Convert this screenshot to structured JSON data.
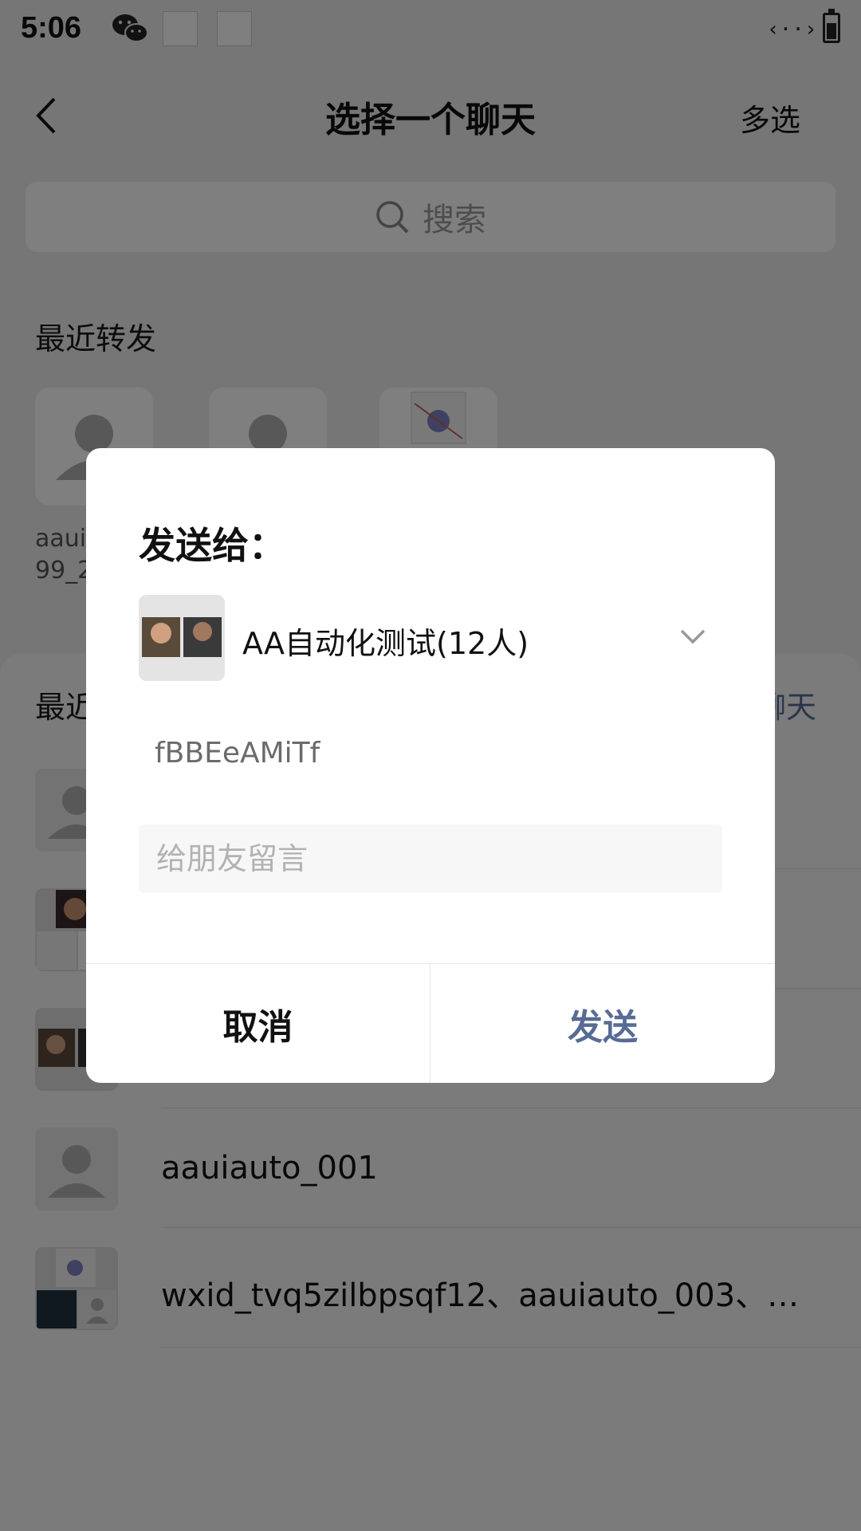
{
  "status_bar": {
    "time": "5:06",
    "data_icon": "‹··›",
    "icons": [
      "wechat-icon",
      "notification-square",
      "notification-square",
      "data-transfer-icon",
      "battery-icon"
    ]
  },
  "header": {
    "title": "选择一个聊天",
    "multi_select": "多选"
  },
  "search": {
    "placeholder": "搜索"
  },
  "recent_forward": {
    "title": "最近转发",
    "items": [
      {
        "name_line1": "aaui",
        "name_line2": "99_2"
      },
      {
        "name_line1": "",
        "name_line2": ""
      },
      {
        "name_line1": "",
        "name_line2": ""
      }
    ]
  },
  "recent_chats": {
    "title": "最近",
    "link": "聊天",
    "items": [
      {
        "name": ""
      },
      {
        "name": ""
      },
      {
        "name": ""
      },
      {
        "name": "aauiauto_001"
      },
      {
        "name": "wxid_tvq5zilbpsqf12、aauiauto_003、…"
      }
    ]
  },
  "dialog": {
    "title": "发送给：",
    "recipient": "AA自动化测试(12人)",
    "message": "fBBEeAMiTf",
    "input_placeholder": "给朋友留言",
    "cancel": "取消",
    "send": "发送"
  },
  "colors": {
    "link": "#576b95",
    "overlay": "rgba(0,0,0,0.5)",
    "background": "#ededed"
  }
}
